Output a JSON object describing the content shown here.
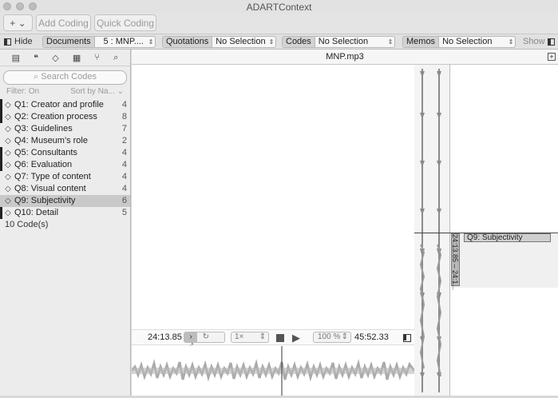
{
  "window": {
    "title": "ADARTContext"
  },
  "toolbar": {
    "add_symbol": "+ ⌄",
    "add_coding": "Add Coding",
    "quick_coding": "Quick Coding"
  },
  "selectors": {
    "hide": "Hide",
    "documents_label": "Documents",
    "documents_value": "5 : MNP....",
    "quotations_label": "Quotations",
    "quotations_value": "No Selection",
    "codes_label": "Codes",
    "codes_value": "No Selection",
    "memos_label": "Memos",
    "memos_value": "No Selection",
    "show": "Show"
  },
  "sidebar": {
    "search_placeholder": "Search Codes",
    "filter": "Filter: On",
    "sort": "Sort by Na...",
    "codes": [
      {
        "name": "Q1: Creator and profile",
        "count": "4"
      },
      {
        "name": "Q2: Creation process",
        "count": "8"
      },
      {
        "name": "Q3: Guidelines",
        "count": "7"
      },
      {
        "name": "Q4: Museum's role",
        "count": "2"
      },
      {
        "name": "Q5: Consultants",
        "count": "4"
      },
      {
        "name": "Q6: Evaluation",
        "count": "4"
      },
      {
        "name": "Q7: Type of content",
        "count": "4"
      },
      {
        "name": "Q8: Visual content",
        "count": "4"
      },
      {
        "name": "Q9: Subjectivity",
        "count": "6"
      },
      {
        "name": "Q10: Detail",
        "count": "5"
      }
    ],
    "code_count": "10 Code(s)"
  },
  "document": {
    "title": "MNP.mp3"
  },
  "quotation": {
    "code": "Q9: Subjectivity",
    "range": "24:13.85 – 24:1..."
  },
  "player": {
    "current_time": "24:13.85",
    "speed": "1×",
    "zoom": "100 %",
    "total_time": "45:52.33"
  }
}
